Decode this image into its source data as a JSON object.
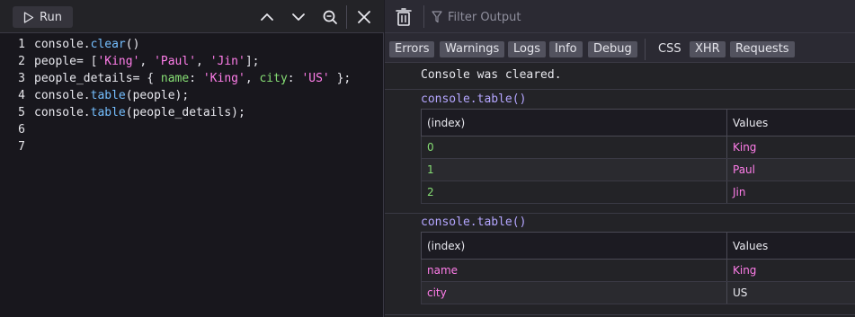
{
  "editor": {
    "run_label": "Run",
    "lines": [
      {
        "num": "1",
        "tokens": [
          {
            "t": "console.",
            "c": "src"
          },
          {
            "t": "clear",
            "c": "t-fn"
          },
          {
            "t": "()",
            "c": "src"
          }
        ]
      },
      {
        "num": "2",
        "tokens": [
          {
            "t": "people= [",
            "c": "src"
          },
          {
            "t": "'King'",
            "c": "t-str"
          },
          {
            "t": ", ",
            "c": "src"
          },
          {
            "t": "'Paul'",
            "c": "t-str"
          },
          {
            "t": ", ",
            "c": "src"
          },
          {
            "t": "'Jin'",
            "c": "t-str"
          },
          {
            "t": "];",
            "c": "src"
          }
        ]
      },
      {
        "num": "3",
        "tokens": [
          {
            "t": "people_details= { ",
            "c": "src"
          },
          {
            "t": "name",
            "c": "t-prop"
          },
          {
            "t": ": ",
            "c": "src"
          },
          {
            "t": "'King'",
            "c": "t-str"
          },
          {
            "t": ", ",
            "c": "src"
          },
          {
            "t": "city",
            "c": "t-prop"
          },
          {
            "t": ": ",
            "c": "src"
          },
          {
            "t": "'US'",
            "c": "t-str"
          },
          {
            "t": " };",
            "c": "src"
          }
        ]
      },
      {
        "num": "4",
        "tokens": [
          {
            "t": "console.",
            "c": "src"
          },
          {
            "t": "table",
            "c": "t-fn"
          },
          {
            "t": "(people);",
            "c": "src"
          }
        ]
      },
      {
        "num": "5",
        "tokens": [
          {
            "t": "console.",
            "c": "src"
          },
          {
            "t": "table",
            "c": "t-fn"
          },
          {
            "t": "(people_details);",
            "c": "src"
          }
        ]
      },
      {
        "num": "6",
        "tokens": []
      },
      {
        "num": "7",
        "tokens": []
      }
    ]
  },
  "console": {
    "filter_placeholder": "Filter Output",
    "filters": [
      "Errors",
      "Warnings",
      "Logs",
      "Info",
      "Debug"
    ],
    "filters_secondary": [
      "CSS",
      "XHR",
      "Requests"
    ],
    "cleared_message": "Console was cleared.",
    "tables": [
      {
        "label": "console.table()",
        "headers": [
          "(index)",
          "Values"
        ],
        "rows": [
          {
            "index": "0",
            "value": "King",
            "index_type": "num",
            "value_type": "str"
          },
          {
            "index": "1",
            "value": "Paul",
            "index_type": "num",
            "value_type": "str"
          },
          {
            "index": "2",
            "value": "Jin",
            "index_type": "num",
            "value_type": "str"
          }
        ]
      },
      {
        "label": "console.table()",
        "headers": [
          "(index)",
          "Values"
        ],
        "rows": [
          {
            "index": "name",
            "value": "King",
            "index_type": "key",
            "value_type": "str"
          },
          {
            "index": "city",
            "value": "US",
            "index_type": "key",
            "value_type": "plain"
          }
        ]
      }
    ]
  },
  "icons": {
    "run": "play-icon",
    "prev": "chevron-up-icon",
    "next": "chevron-down-icon",
    "search": "search-icon",
    "close": "close-icon",
    "trash": "trash-icon",
    "filter": "filter-icon"
  }
}
